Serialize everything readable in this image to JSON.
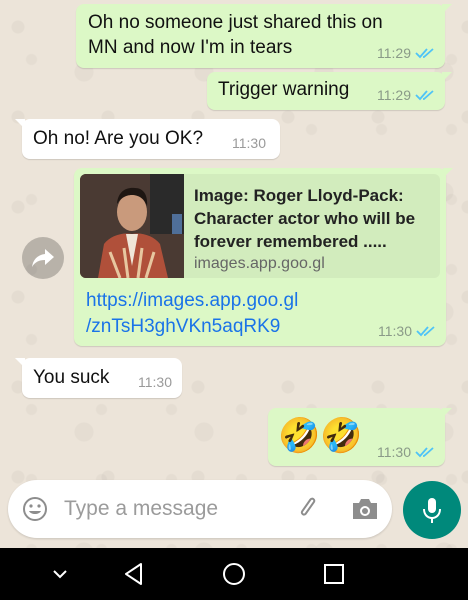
{
  "messages": [
    {
      "type": "outgoing",
      "text": "Oh no someone just shared this on MN and now I'm in tears",
      "lines": [
        "Oh no someone just shared this on",
        "MN and now I'm in tears"
      ],
      "time": "11:29"
    },
    {
      "type": "outgoing",
      "text": "Trigger warning",
      "time": "11:29"
    },
    {
      "type": "incoming",
      "text": "Oh no! Are you OK?",
      "time": "11:30"
    },
    {
      "type": "outgoing_link",
      "preview_title_lines": [
        "Image: Roger Lloyd-Pack:",
        "Character actor who will be",
        "forever remembered ....."
      ],
      "preview_domain": "images.app.goo.gl",
      "link_lines": [
        "https://images.app.goo.gl",
        "/znTsH3ghVKn5aqRK9"
      ],
      "time": "11:30"
    },
    {
      "type": "incoming",
      "text": "You suck",
      "time": "11:30"
    },
    {
      "type": "outgoing",
      "text": "🤣🤣",
      "time": "11:30"
    }
  ],
  "composer": {
    "placeholder": "Type a message"
  },
  "icons": [
    "emoji-icon",
    "attach-icon",
    "camera-icon",
    "mic-icon",
    "forward-icon",
    "double-check-icon",
    "nav-back-icon",
    "nav-home-icon",
    "nav-recents-icon",
    "nav-collapse-icon"
  ],
  "colors": {
    "outgoing_bubble": "#dcf8c6",
    "incoming_bubble": "#ffffff",
    "read_ticks": "#4fc3f7",
    "accent": "#00897b",
    "link": "#1a73e8"
  }
}
